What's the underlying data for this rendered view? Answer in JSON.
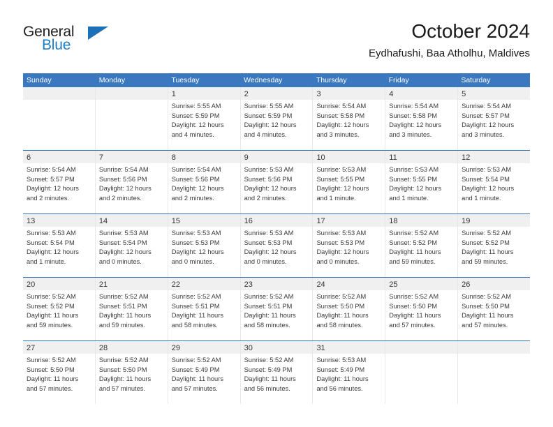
{
  "brand": {
    "word_one": "General",
    "word_two": "Blue",
    "triangle_icon": "triangle-icon",
    "accent_color": "#1d7dc4"
  },
  "header": {
    "month_title": "October 2024",
    "location": "Eydhafushi, Baa Atholhu, Maldives"
  },
  "calendar": {
    "header_color": "#3a78bf",
    "weekday_headers": [
      "Sunday",
      "Monday",
      "Tuesday",
      "Wednesday",
      "Thursday",
      "Friday",
      "Saturday"
    ],
    "weeks": [
      [
        {
          "day": "",
          "empty": true
        },
        {
          "day": "",
          "empty": true
        },
        {
          "day": "1",
          "sunrise": "Sunrise: 5:55 AM",
          "sunset": "Sunset: 5:59 PM",
          "daylight_line1": "Daylight: 12 hours",
          "daylight_line2": "and 4 minutes."
        },
        {
          "day": "2",
          "sunrise": "Sunrise: 5:55 AM",
          "sunset": "Sunset: 5:59 PM",
          "daylight_line1": "Daylight: 12 hours",
          "daylight_line2": "and 4 minutes."
        },
        {
          "day": "3",
          "sunrise": "Sunrise: 5:54 AM",
          "sunset": "Sunset: 5:58 PM",
          "daylight_line1": "Daylight: 12 hours",
          "daylight_line2": "and 3 minutes."
        },
        {
          "day": "4",
          "sunrise": "Sunrise: 5:54 AM",
          "sunset": "Sunset: 5:58 PM",
          "daylight_line1": "Daylight: 12 hours",
          "daylight_line2": "and 3 minutes."
        },
        {
          "day": "5",
          "sunrise": "Sunrise: 5:54 AM",
          "sunset": "Sunset: 5:57 PM",
          "daylight_line1": "Daylight: 12 hours",
          "daylight_line2": "and 3 minutes."
        }
      ],
      [
        {
          "day": "6",
          "sunrise": "Sunrise: 5:54 AM",
          "sunset": "Sunset: 5:57 PM",
          "daylight_line1": "Daylight: 12 hours",
          "daylight_line2": "and 2 minutes."
        },
        {
          "day": "7",
          "sunrise": "Sunrise: 5:54 AM",
          "sunset": "Sunset: 5:56 PM",
          "daylight_line1": "Daylight: 12 hours",
          "daylight_line2": "and 2 minutes."
        },
        {
          "day": "8",
          "sunrise": "Sunrise: 5:54 AM",
          "sunset": "Sunset: 5:56 PM",
          "daylight_line1": "Daylight: 12 hours",
          "daylight_line2": "and 2 minutes."
        },
        {
          "day": "9",
          "sunrise": "Sunrise: 5:53 AM",
          "sunset": "Sunset: 5:56 PM",
          "daylight_line1": "Daylight: 12 hours",
          "daylight_line2": "and 2 minutes."
        },
        {
          "day": "10",
          "sunrise": "Sunrise: 5:53 AM",
          "sunset": "Sunset: 5:55 PM",
          "daylight_line1": "Daylight: 12 hours",
          "daylight_line2": "and 1 minute."
        },
        {
          "day": "11",
          "sunrise": "Sunrise: 5:53 AM",
          "sunset": "Sunset: 5:55 PM",
          "daylight_line1": "Daylight: 12 hours",
          "daylight_line2": "and 1 minute."
        },
        {
          "day": "12",
          "sunrise": "Sunrise: 5:53 AM",
          "sunset": "Sunset: 5:54 PM",
          "daylight_line1": "Daylight: 12 hours",
          "daylight_line2": "and 1 minute."
        }
      ],
      [
        {
          "day": "13",
          "sunrise": "Sunrise: 5:53 AM",
          "sunset": "Sunset: 5:54 PM",
          "daylight_line1": "Daylight: 12 hours",
          "daylight_line2": "and 1 minute."
        },
        {
          "day": "14",
          "sunrise": "Sunrise: 5:53 AM",
          "sunset": "Sunset: 5:54 PM",
          "daylight_line1": "Daylight: 12 hours",
          "daylight_line2": "and 0 minutes."
        },
        {
          "day": "15",
          "sunrise": "Sunrise: 5:53 AM",
          "sunset": "Sunset: 5:53 PM",
          "daylight_line1": "Daylight: 12 hours",
          "daylight_line2": "and 0 minutes."
        },
        {
          "day": "16",
          "sunrise": "Sunrise: 5:53 AM",
          "sunset": "Sunset: 5:53 PM",
          "daylight_line1": "Daylight: 12 hours",
          "daylight_line2": "and 0 minutes."
        },
        {
          "day": "17",
          "sunrise": "Sunrise: 5:53 AM",
          "sunset": "Sunset: 5:53 PM",
          "daylight_line1": "Daylight: 12 hours",
          "daylight_line2": "and 0 minutes."
        },
        {
          "day": "18",
          "sunrise": "Sunrise: 5:52 AM",
          "sunset": "Sunset: 5:52 PM",
          "daylight_line1": "Daylight: 11 hours",
          "daylight_line2": "and 59 minutes."
        },
        {
          "day": "19",
          "sunrise": "Sunrise: 5:52 AM",
          "sunset": "Sunset: 5:52 PM",
          "daylight_line1": "Daylight: 11 hours",
          "daylight_line2": "and 59 minutes."
        }
      ],
      [
        {
          "day": "20",
          "sunrise": "Sunrise: 5:52 AM",
          "sunset": "Sunset: 5:52 PM",
          "daylight_line1": "Daylight: 11 hours",
          "daylight_line2": "and 59 minutes."
        },
        {
          "day": "21",
          "sunrise": "Sunrise: 5:52 AM",
          "sunset": "Sunset: 5:51 PM",
          "daylight_line1": "Daylight: 11 hours",
          "daylight_line2": "and 59 minutes."
        },
        {
          "day": "22",
          "sunrise": "Sunrise: 5:52 AM",
          "sunset": "Sunset: 5:51 PM",
          "daylight_line1": "Daylight: 11 hours",
          "daylight_line2": "and 58 minutes."
        },
        {
          "day": "23",
          "sunrise": "Sunrise: 5:52 AM",
          "sunset": "Sunset: 5:51 PM",
          "daylight_line1": "Daylight: 11 hours",
          "daylight_line2": "and 58 minutes."
        },
        {
          "day": "24",
          "sunrise": "Sunrise: 5:52 AM",
          "sunset": "Sunset: 5:50 PM",
          "daylight_line1": "Daylight: 11 hours",
          "daylight_line2": "and 58 minutes."
        },
        {
          "day": "25",
          "sunrise": "Sunrise: 5:52 AM",
          "sunset": "Sunset: 5:50 PM",
          "daylight_line1": "Daylight: 11 hours",
          "daylight_line2": "and 57 minutes."
        },
        {
          "day": "26",
          "sunrise": "Sunrise: 5:52 AM",
          "sunset": "Sunset: 5:50 PM",
          "daylight_line1": "Daylight: 11 hours",
          "daylight_line2": "and 57 minutes."
        }
      ],
      [
        {
          "day": "27",
          "sunrise": "Sunrise: 5:52 AM",
          "sunset": "Sunset: 5:50 PM",
          "daylight_line1": "Daylight: 11 hours",
          "daylight_line2": "and 57 minutes."
        },
        {
          "day": "28",
          "sunrise": "Sunrise: 5:52 AM",
          "sunset": "Sunset: 5:50 PM",
          "daylight_line1": "Daylight: 11 hours",
          "daylight_line2": "and 57 minutes."
        },
        {
          "day": "29",
          "sunrise": "Sunrise: 5:52 AM",
          "sunset": "Sunset: 5:49 PM",
          "daylight_line1": "Daylight: 11 hours",
          "daylight_line2": "and 57 minutes."
        },
        {
          "day": "30",
          "sunrise": "Sunrise: 5:52 AM",
          "sunset": "Sunset: 5:49 PM",
          "daylight_line1": "Daylight: 11 hours",
          "daylight_line2": "and 56 minutes."
        },
        {
          "day": "31",
          "sunrise": "Sunrise: 5:53 AM",
          "sunset": "Sunset: 5:49 PM",
          "daylight_line1": "Daylight: 11 hours",
          "daylight_line2": "and 56 minutes."
        },
        {
          "day": "",
          "empty": true
        },
        {
          "day": "",
          "empty": true
        }
      ]
    ]
  }
}
